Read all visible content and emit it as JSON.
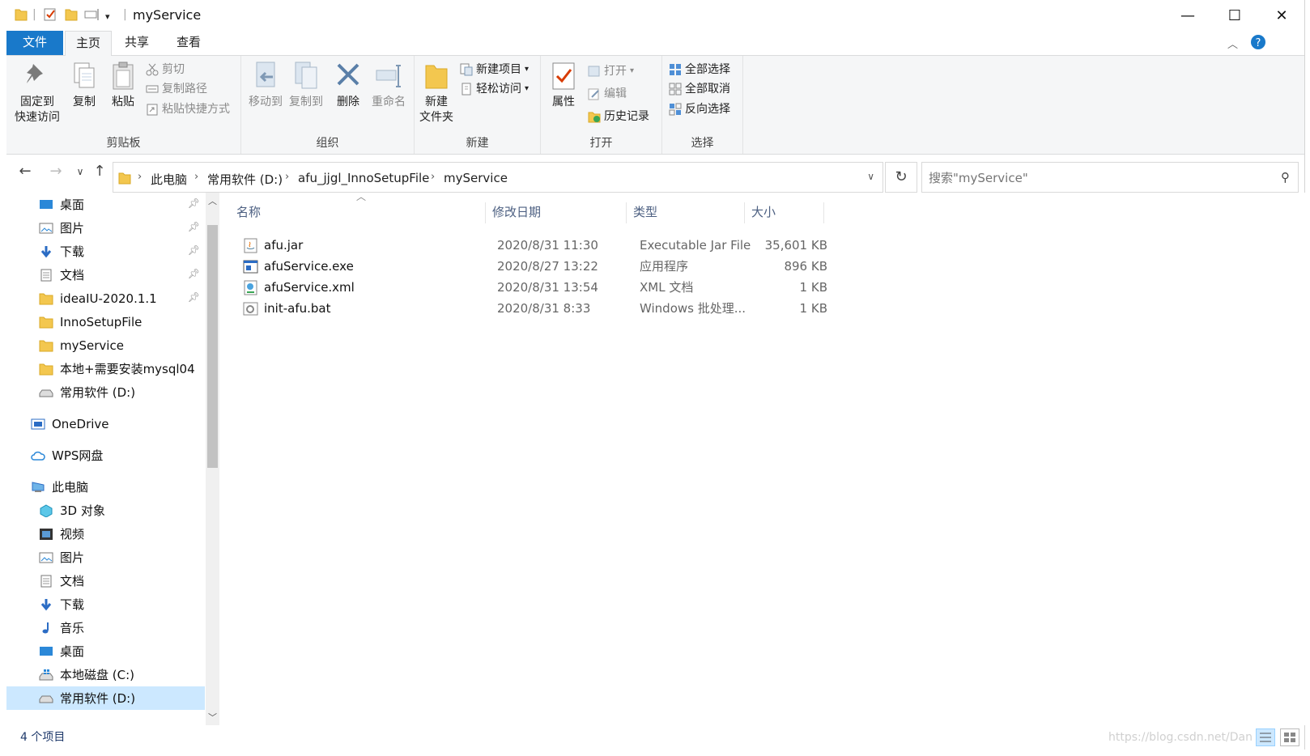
{
  "window": {
    "title": "myService",
    "controls": {
      "minimize": "—",
      "maximize": "☐",
      "close": "✕"
    }
  },
  "ribbon_tabs": {
    "file": "文件",
    "home": "主页",
    "share": "共享",
    "view": "查看"
  },
  "ribbon": {
    "clipboard": {
      "label": "剪贴板",
      "pin": "固定到快速访问",
      "pin_l1": "固定到",
      "pin_l2": "快速访问",
      "copy": "复制",
      "paste": "粘贴",
      "cut": "剪切",
      "copy_path": "复制路径",
      "paste_shortcut": "粘贴快捷方式"
    },
    "organize": {
      "label": "组织",
      "move_to": "移动到",
      "copy_to": "复制到",
      "delete": "删除",
      "rename": "重命名"
    },
    "new": {
      "label": "新建",
      "new_folder_l1": "新建",
      "new_folder_l2": "文件夹",
      "new_item": "新建项目",
      "easy_access": "轻松访问"
    },
    "open": {
      "label": "打开",
      "properties": "属性",
      "open": "打开",
      "edit": "编辑",
      "history": "历史记录"
    },
    "select": {
      "label": "选择",
      "select_all": "全部选择",
      "select_none": "全部取消",
      "invert": "反向选择"
    }
  },
  "breadcrumb": [
    "此电脑",
    "常用软件 (D:)",
    "afu_jjgl_InnoSetupFile",
    "myService"
  ],
  "search": {
    "placeholder": "搜索\"myService\""
  },
  "nav_items": [
    {
      "label": "桌面",
      "pinned": true
    },
    {
      "label": "图片",
      "pinned": true
    },
    {
      "label": "下载",
      "pinned": true
    },
    {
      "label": "文档",
      "pinned": true
    },
    {
      "label": "ideaIU-2020.1.1",
      "pinned": true
    },
    {
      "label": "InnoSetupFile"
    },
    {
      "label": "myService"
    },
    {
      "label": "本地+需要安装mysql04"
    },
    {
      "label": "常用软件 (D:)"
    },
    {
      "label": "OneDrive"
    },
    {
      "label": "WPS网盘"
    },
    {
      "label": "此电脑"
    },
    {
      "label": "3D 对象"
    },
    {
      "label": "视频"
    },
    {
      "label": "图片"
    },
    {
      "label": "文档"
    },
    {
      "label": "下载"
    },
    {
      "label": "音乐"
    },
    {
      "label": "桌面"
    },
    {
      "label": "本地磁盘 (C:)"
    },
    {
      "label": "常用软件 (D:)"
    }
  ],
  "columns": {
    "name": "名称",
    "date": "修改日期",
    "type": "类型",
    "size": "大小"
  },
  "files": [
    {
      "name": "afu.jar",
      "date": "2020/8/31 11:30",
      "type": "Executable Jar File",
      "size": "35,601 KB",
      "icon": "jar-icon"
    },
    {
      "name": "afuService.exe",
      "date": "2020/8/27 13:22",
      "type": "应用程序",
      "size": "896 KB",
      "icon": "exe-icon"
    },
    {
      "name": "afuService.xml",
      "date": "2020/8/31 13:54",
      "type": "XML 文档",
      "size": "1 KB",
      "icon": "xml-icon"
    },
    {
      "name": "init-afu.bat",
      "date": "2020/8/31 8:33",
      "type": "Windows 批处理...",
      "size": "1 KB",
      "icon": "bat-icon"
    }
  ],
  "status": {
    "item_count": "4 个项目"
  },
  "watermark": "https://blog.csdn.net/Dan",
  "colors": {
    "accent": "#1979ca",
    "folder": "#f3c74f",
    "selection": "#cce8ff"
  }
}
